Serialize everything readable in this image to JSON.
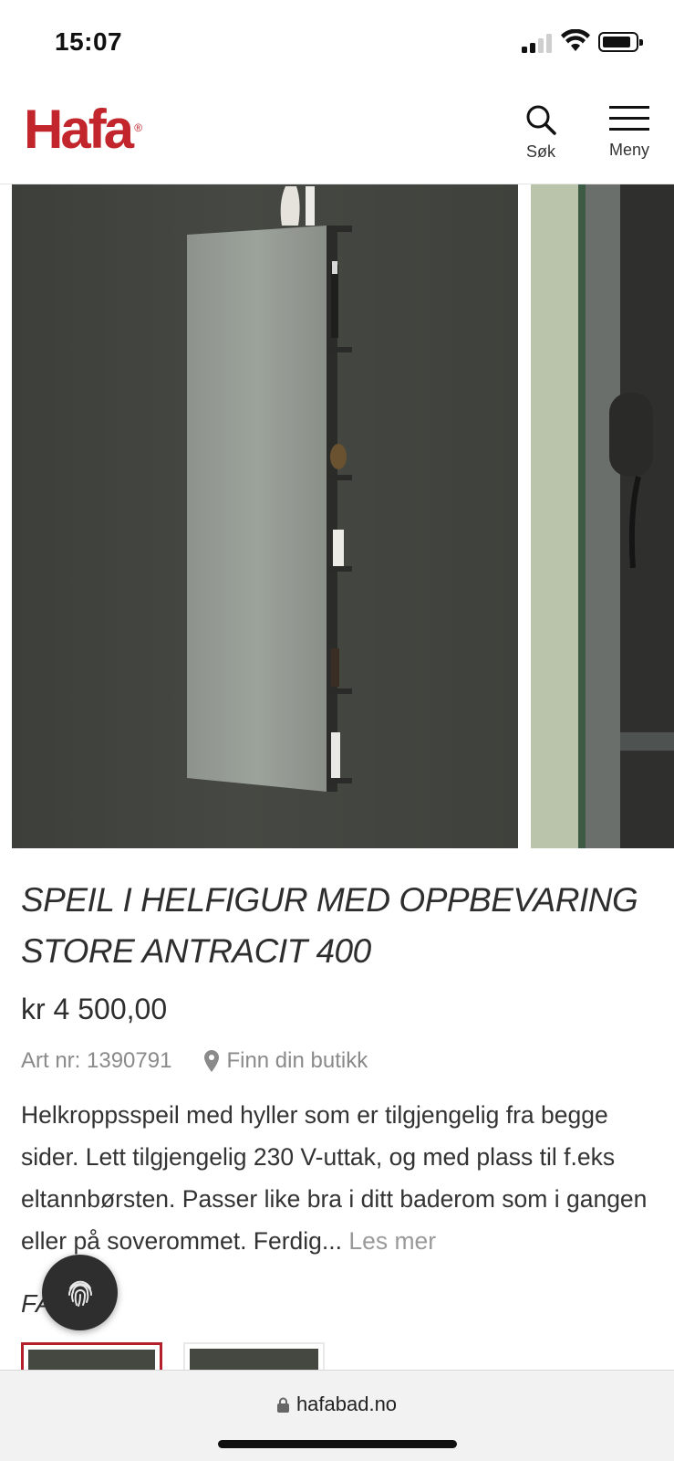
{
  "status_bar": {
    "time": "15:07"
  },
  "header": {
    "logo_text": "Hafa",
    "search_label": "Søk",
    "menu_label": "Meny",
    "brand_color": "#c2252c"
  },
  "product": {
    "title_line1": "SPEIL I HELFIGUR MED OPPBEVARING",
    "title_line2": "STORE ANTRACIT 400",
    "price": "kr 4 500,00",
    "art_nr": "Art nr: 1390791",
    "store_link": "Finn din butikk",
    "description": "Helkroppsspeil med hyller som er tilgjengelig fra begge sider. Lett tilgjengelig 230 V-uttak, og med plass til f.eks eltannbørsten. Passer like bra i ditt baderom som i gangen eller på soverommet. Ferdig...",
    "read_more": "Les mer",
    "color_section_label": "FA"
  },
  "icons": {
    "search": "search-icon",
    "menu": "hamburger-menu-icon",
    "location": "location-pin-icon",
    "fingerprint": "fingerprint-icon",
    "lock": "lock-icon"
  },
  "browser": {
    "url": "hafabad.no"
  }
}
